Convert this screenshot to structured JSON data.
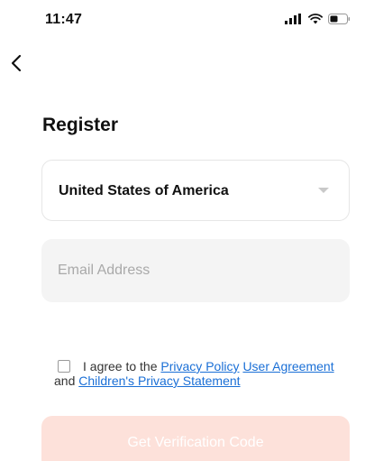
{
  "status_bar": {
    "time": "11:47",
    "icons": [
      "signal-icon",
      "wifi-icon",
      "battery-icon"
    ]
  },
  "nav": {
    "back_icon": "chevron-left-icon"
  },
  "register": {
    "title": "Register",
    "country": "United States of America",
    "email_placeholder": "Email Address",
    "email_value": "",
    "agreement": {
      "prefix": "I agree to the",
      "privacy_policy": "Privacy Policy",
      "user_agreement": "User Agreement",
      "conjunction": "and",
      "childrens_privacy": "Children's Privacy Statement"
    },
    "verify_button": "Get Verification Code"
  },
  "colors": {
    "button_disabled_bg": "#fde1da",
    "link": "#1a6fd6",
    "field_bg": "#f4f4f4"
  }
}
